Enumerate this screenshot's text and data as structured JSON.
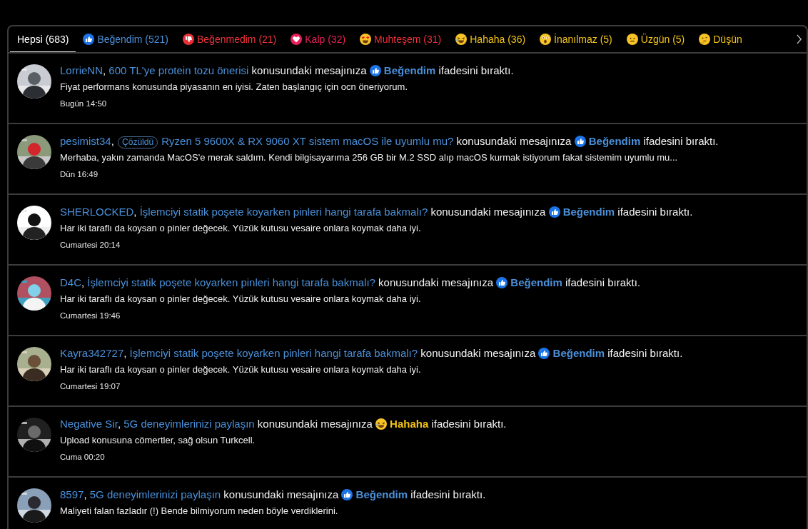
{
  "tabs": [
    {
      "label": "Hepsi (683)",
      "kind": "all",
      "color": "#ffffff",
      "selected": true
    },
    {
      "label": "Beğendim (521)",
      "kind": "like",
      "color": "#4a90d9",
      "selected": false
    },
    {
      "label": "Beğenmedim (21)",
      "kind": "dislike",
      "color": "#f0343c",
      "selected": false
    },
    {
      "label": "Kalp (32)",
      "kind": "heart",
      "color": "#e8205a",
      "selected": false
    },
    {
      "label": "Muhteşem (31)",
      "kind": "love",
      "color": "#f0303c",
      "selected": false
    },
    {
      "label": "Hahaha (36)",
      "kind": "haha",
      "color": "#f5c518",
      "selected": false
    },
    {
      "label": "İnanılmaz (5)",
      "kind": "wow",
      "color": "#f5c518",
      "selected": false
    },
    {
      "label": "Üzgün (5)",
      "kind": "sad",
      "color": "#f5c518",
      "selected": false
    },
    {
      "label": "Düşün",
      "kind": "think",
      "color": "#f5c518",
      "selected": false
    }
  ],
  "notifications": [
    {
      "user": "LorrieNN",
      "separator": ",",
      "thread": "600 TL'ye protein tozu önerisi",
      "middle": "konusundaki mesajınıza",
      "reaction": {
        "kind": "like",
        "label": "Beğendim"
      },
      "end": "ifadesini bıraktı.",
      "body": "Fiyat performans konusunda piyasanın en iyisi. Zaten başlangıç için ocn öneriyorum.",
      "time": "Bugün 14:50"
    },
    {
      "user": "pesimist34",
      "separator": ",",
      "prefix": "Çözüldü",
      "thread": "Ryzen 5 9600X & RX 9060 XT sistem macOS ile uyumlu mu?",
      "middle": "konusundaki mesajınıza",
      "reaction": {
        "kind": "like",
        "label": "Beğendim"
      },
      "end": "ifadesini bıraktı.",
      "body": "Merhaba, yakın zamanda MacOS'e merak saldım. Kendi bilgisayarıma 256 GB bir M.2 SSD alıp macOS kurmak istiyorum fakat sistemim uyumlu mu...",
      "time": "Dün 16:49"
    },
    {
      "user": "SHERLOCKED",
      "separator": ",",
      "thread": "İşlemciyi statik poşete koyarken pinleri hangi tarafa bakmalı?",
      "middle": "konusundaki mesajınıza",
      "reaction": {
        "kind": "like",
        "label": "Beğendim"
      },
      "end": "ifadesini bıraktı.",
      "body": "Har iki taraflı da koysan o pinler değecek. Yüzük kutusu vesaire onlara koymak daha iyi.",
      "time": "Cumartesi 20:14"
    },
    {
      "user": "D4C",
      "separator": ",",
      "thread": "İşlemciyi statik poşete koyarken pinleri hangi tarafa bakmalı?",
      "middle": "konusundaki mesajınıza",
      "reaction": {
        "kind": "like",
        "label": "Beğendim"
      },
      "end": "ifadesini bıraktı.",
      "body": "Har iki taraflı da koysan o pinler değecek. Yüzük kutusu vesaire onlara koymak daha iyi.",
      "time": "Cumartesi 19:46"
    },
    {
      "user": "Kayra342727",
      "separator": ",",
      "thread": "İşlemciyi statik poşete koyarken pinleri hangi tarafa bakmalı?",
      "middle": "konusundaki mesajınıza",
      "reaction": {
        "kind": "like",
        "label": "Beğendim"
      },
      "end": "ifadesini bıraktı.",
      "body": "Har iki taraflı da koysan o pinler değecek. Yüzük kutusu vesaire onlara koymak daha iyi.",
      "time": "Cumartesi 19:07"
    },
    {
      "user": "Negative Sir",
      "separator": ",",
      "thread": "5G deneyimlerinizi paylaşın",
      "middle": "konusundaki mesajınıza",
      "reaction": {
        "kind": "haha",
        "label": "Hahaha"
      },
      "end": "ifadesini bıraktı.",
      "body": "Upload konusuna cömertler, sağ olsun Turkcell.",
      "time": "Cuma 00:20"
    },
    {
      "user": "8597",
      "separator": ",",
      "thread": "5G deneyimlerinizi paylaşın",
      "middle": "konusundaki mesajınıza",
      "reaction": {
        "kind": "like",
        "label": "Beğendim"
      },
      "end": "ifadesini bıraktı.",
      "body": "Maliyeti falan fazladır (!) Bende bilmiyorum neden böyle verdiklerini."
    }
  ]
}
